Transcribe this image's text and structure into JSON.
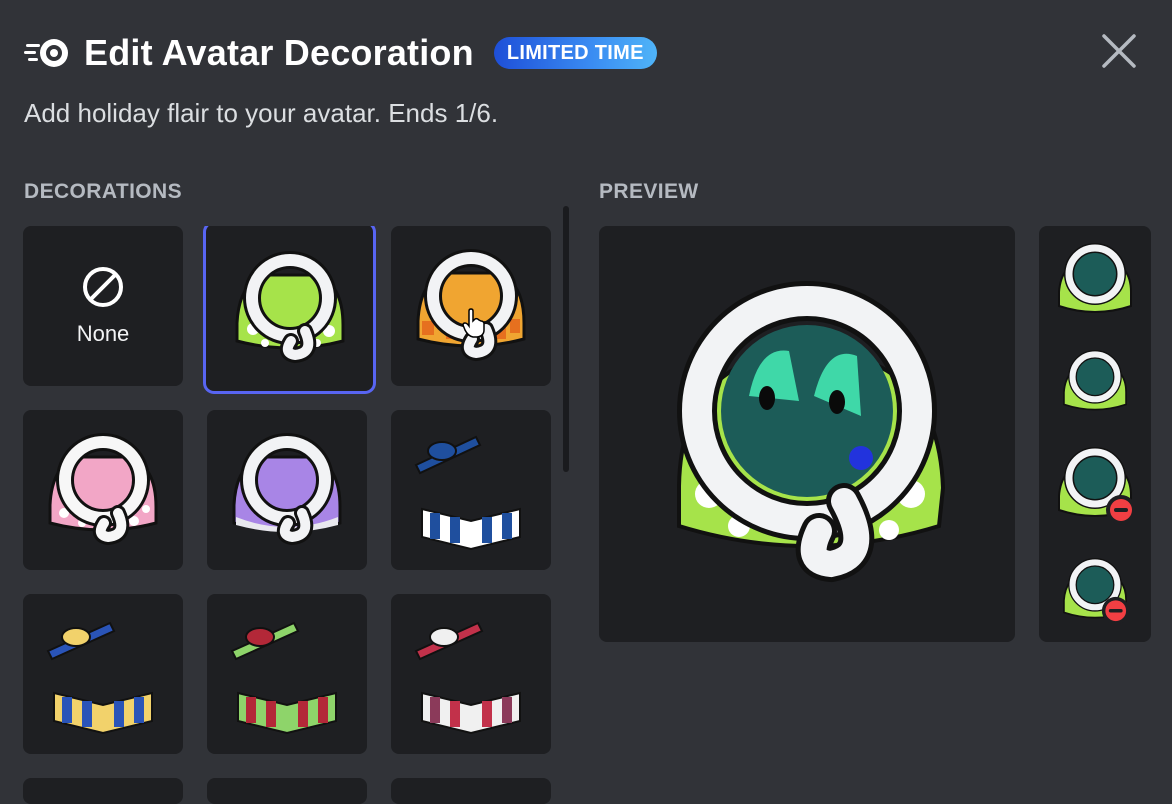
{
  "header": {
    "title": "Edit Avatar Decoration",
    "badge": "LIMITED TIME",
    "subtitle": "Add holiday flair to your avatar. Ends 1/6."
  },
  "sections": {
    "decorations_label": "DECORATIONS",
    "preview_label": "PREVIEW"
  },
  "decorations": [
    {
      "label": "None",
      "kind": "none",
      "selected": false
    },
    {
      "kind": "scarf",
      "colors": [
        "#a6e34a",
        "#f2f3f5"
      ],
      "selected": true
    },
    {
      "kind": "scarf",
      "colors": [
        "#f0a531",
        "#f2f3f5"
      ],
      "selected": false
    },
    {
      "kind": "scarf",
      "colors": [
        "#f2a6c6",
        "#f7f7f7"
      ],
      "selected": false
    },
    {
      "kind": "scarf",
      "colors": [
        "#a885e6",
        "#f2f3f5"
      ],
      "selected": false
    },
    {
      "kind": "gift-box",
      "colors": [
        "#1f4f9e",
        "#ffffff"
      ],
      "selected": false
    },
    {
      "kind": "gift-box",
      "colors": [
        "#f2d26b",
        "#2a54b8"
      ],
      "selected": false
    },
    {
      "kind": "gift-box",
      "colors": [
        "#b32838",
        "#8ed46a"
      ],
      "selected": false
    },
    {
      "kind": "gift-box",
      "colors": [
        "#f0f0f0",
        "#c2314a"
      ],
      "selected": false
    }
  ],
  "colors": {
    "accent": "#5865f2",
    "background": "#313338",
    "tile": "#1e1f22",
    "badge_start": "#1e4fd8",
    "badge_end": "#4fb4f8",
    "status_dnd": "#f23f43"
  },
  "icons": {
    "nitro": "nitro-icon",
    "close": "close-icon",
    "none": "block-icon",
    "cursor": "hand-cursor-icon",
    "dnd": "do-not-disturb-icon"
  }
}
